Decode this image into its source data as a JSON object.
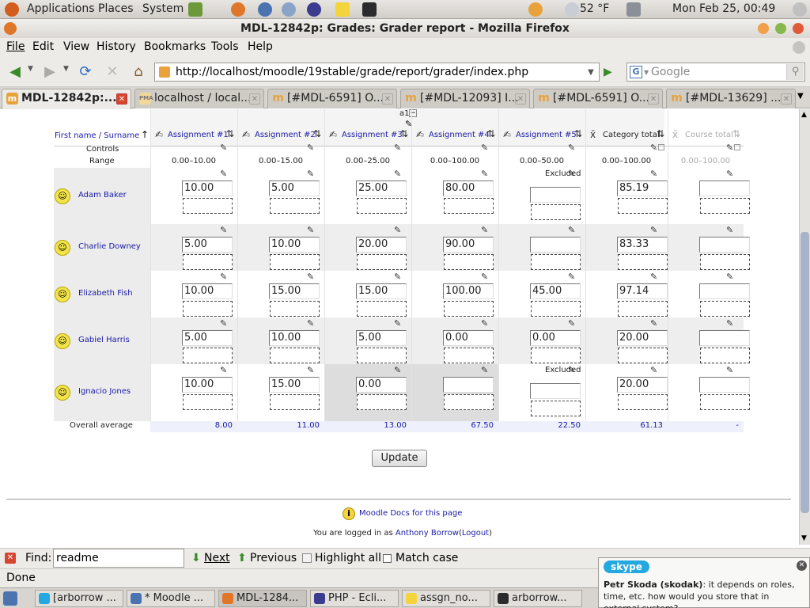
{
  "gnome_panel": {
    "menus": [
      "Applications",
      "Places",
      "System"
    ],
    "weather": "52 °F",
    "clock": "Mon Feb 25, 00:49"
  },
  "window": {
    "title": "MDL-12842p: Grades: Grader report - Mozilla Firefox"
  },
  "menubar": [
    "File",
    "Edit",
    "View",
    "History",
    "Bookmarks",
    "Tools",
    "Help"
  ],
  "nav": {
    "url": "http://localhost/moodle/19stable/grade/report/grader/index.php",
    "search_placeholder": "Google"
  },
  "tabs": [
    {
      "label": "MDL-12842p:...",
      "icon": "moodle-favicon"
    },
    {
      "label": "localhost / local...",
      "icon": "phpmyadmin-favicon"
    },
    {
      "label": "[#MDL-6591] O...",
      "icon": "moodle-m-icon"
    },
    {
      "label": "[#MDL-12093] I...",
      "icon": "moodle-m-icon"
    },
    {
      "label": "[#MDL-6591] O...",
      "icon": "moodle-m-icon"
    },
    {
      "label": "[#MDL-13629] ...",
      "icon": "moodle-m-icon"
    }
  ],
  "grader": {
    "category_label": "a1",
    "name_header": "First name / Surname",
    "columns": [
      {
        "label": "Assignment #1",
        "range": "0.00–10.00",
        "average": "8.00"
      },
      {
        "label": "Assignment #2",
        "range": "0.00–15.00",
        "average": "11.00"
      },
      {
        "label": "Assignment #3",
        "range": "0.00–25.00",
        "average": "13.00"
      },
      {
        "label": "Assignment #4",
        "range": "0.00–100.00",
        "average": "67.50"
      },
      {
        "label": "Assignment #5",
        "range": "0.00–50.00",
        "average": "22.50"
      },
      {
        "label": "Category total",
        "range": "0.00–100.00",
        "average": "61.13"
      },
      {
        "label": "Course total",
        "range": "0.00–100.00",
        "average": "-"
      }
    ],
    "controls_label": "Controls",
    "range_label": "Range",
    "students": [
      {
        "name": "Adam Baker",
        "grades": [
          "10.00",
          "5.00",
          "25.00",
          "80.00",
          "",
          "85.19",
          ""
        ],
        "excluded": [
          false,
          false,
          false,
          false,
          true,
          false,
          false
        ]
      },
      {
        "name": "Charlie Downey",
        "grades": [
          "5.00",
          "10.00",
          "20.00",
          "90.00",
          "",
          "83.33",
          ""
        ],
        "excluded": [
          false,
          false,
          false,
          false,
          false,
          false,
          false
        ]
      },
      {
        "name": "Elizabeth Fish",
        "grades": [
          "10.00",
          "15.00",
          "15.00",
          "100.00",
          "45.00",
          "97.14",
          ""
        ],
        "excluded": [
          false,
          false,
          false,
          false,
          false,
          false,
          false
        ]
      },
      {
        "name": "Gabiel Harris",
        "grades": [
          "5.00",
          "10.00",
          "5.00",
          "0.00",
          "0.00",
          "20.00",
          ""
        ],
        "excluded": [
          false,
          false,
          false,
          false,
          false,
          false,
          false
        ]
      },
      {
        "name": "Ignacio Jones",
        "grades": [
          "10.00",
          "15.00",
          "0.00",
          "",
          "",
          "20.00",
          ""
        ],
        "excluded": [
          false,
          false,
          false,
          false,
          true,
          false,
          false
        ]
      }
    ],
    "excluded_text": "Excluded",
    "overall_average_label": "Overall average",
    "update_button": "Update",
    "docs_link": "Moodle Docs for this page",
    "logged_in_prefix": "You are logged in as",
    "user_name": "Anthony Borrow",
    "logout": "Logout"
  },
  "findbar": {
    "label": "Find:",
    "value": "readme",
    "next": "Next",
    "previous": "Previous",
    "highlight_all": "Highlight all",
    "match_case": "Match case"
  },
  "status": "Done",
  "taskbar": [
    {
      "label": "[arborrow ...",
      "icon": "skype-icon"
    },
    {
      "label": "* Moodle ...",
      "icon": "chat-icon"
    },
    {
      "label": "MDL-1284...",
      "icon": "firefox-icon"
    },
    {
      "label": "PHP - Ecli...",
      "icon": "eclipse-icon"
    },
    {
      "label": "assgn_no...",
      "icon": "editor-icon"
    },
    {
      "label": "arborrow...",
      "icon": "terminal-icon"
    }
  ],
  "skype": {
    "brand": "skype",
    "sender": "Petr Skoda (skodak)",
    "message": ": it depends on roles, time, etc. how would you store that in external system?"
  },
  "colors": {
    "link_blue": "#1a1aa6",
    "row_alt": "#eeeeee",
    "avg_row": "#eef0fb",
    "locked_cell": "#dddddd"
  }
}
